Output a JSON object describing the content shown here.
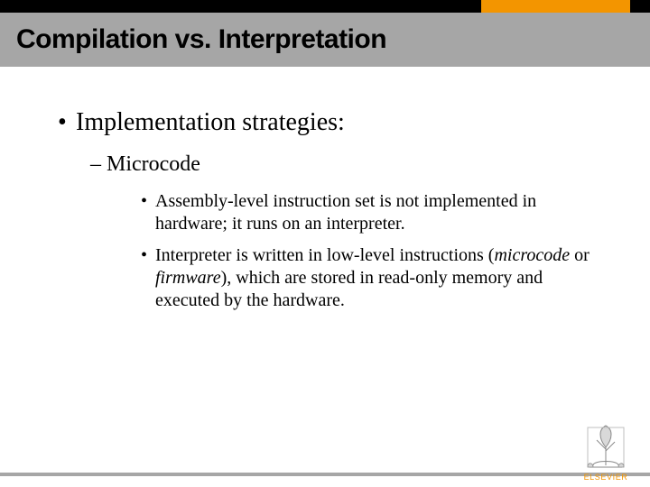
{
  "header": {
    "title": "Compilation vs. Interpretation"
  },
  "content": {
    "level1": "Implementation strategies:",
    "level2": "Microcode",
    "level3": [
      {
        "pre": "Assembly-level instruction set is not implemented in hardware; it runs on an interpreter."
      },
      {
        "pre": "Interpreter is written in low-level instructions (",
        "ital1": "microcode",
        "mid": " or ",
        "ital2": "firmware",
        "post": "), which are stored in read-only memory and executed by the hardware."
      }
    ]
  },
  "publisher": {
    "name": "ELSEVIER"
  },
  "colors": {
    "accent": "#f39500",
    "graybar": "#a6a6a6"
  }
}
